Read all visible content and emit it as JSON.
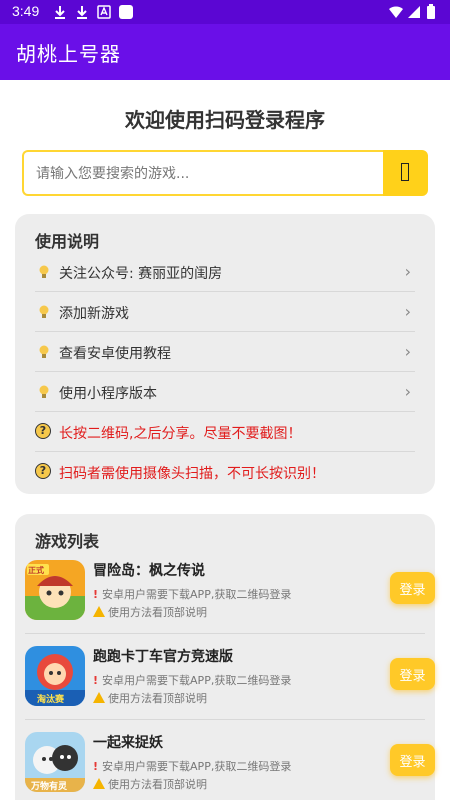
{
  "status": {
    "time": "3:49"
  },
  "app": {
    "title": "胡桃上号器"
  },
  "welcome": "欢迎使用扫码登录程序",
  "search": {
    "placeholder": "请输入您要搜索的游戏..."
  },
  "usage": {
    "title": "使用说明",
    "items": [
      {
        "label": "关注公众号: 赛丽亚的闺房"
      },
      {
        "label": "添加新游戏"
      },
      {
        "label": "查看安卓使用教程"
      },
      {
        "label": "使用小程序版本"
      }
    ],
    "tips": [
      {
        "text": "长按二维码,之后分享。尽量不要截图！"
      },
      {
        "text": "扫码者需使用摄像头扫描，不可长按识别！"
      }
    ]
  },
  "games": {
    "title": "游戏列表",
    "login_label": "登录",
    "list": [
      {
        "name": "冒险岛：枫之传说",
        "note1": "安卓用户需要下载APP,获取二维码登录",
        "note2": "使用方法看顶部说明",
        "icon_badge": "正式"
      },
      {
        "name": "跑跑卡丁车官方竞速版",
        "note1": "安卓用户需要下载APP,获取二维码登录",
        "note2": "使用方法看顶部说明",
        "icon_badge": "淘汰赛"
      },
      {
        "name": "一起来捉妖",
        "note1": "安卓用户需要下载APP,获取二维码登录",
        "note2": "使用方法看顶部说明",
        "icon_badge": "万物有灵"
      }
    ]
  },
  "colors": {
    "status_bar": "#5b06d3",
    "app_bar": "#6a0fe8",
    "accent_yellow": "#ffd11a",
    "tip_red": "#e11c1c"
  }
}
